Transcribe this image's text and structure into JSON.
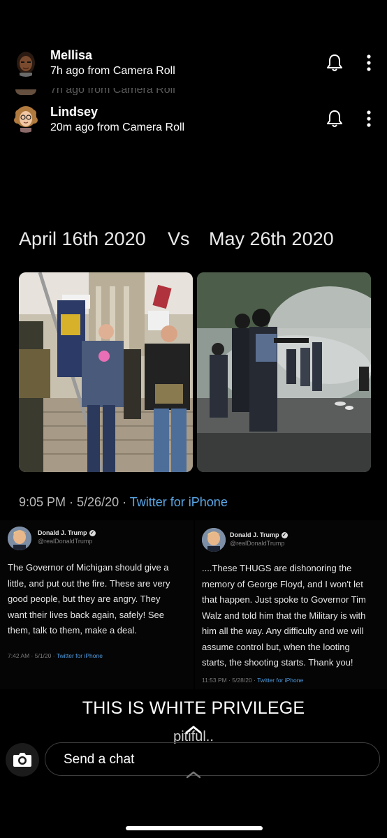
{
  "notifications": [
    {
      "name": "Mellisa",
      "subtitle": "7h ago from Camera Roll"
    },
    {
      "name": "Lindsey",
      "subtitle": "20m ago from Camera Roll"
    }
  ],
  "icons": {
    "bell": "bell-icon",
    "more": "more-vertical-icon",
    "camera": "camera-icon",
    "chevron": "chevron-up-icon"
  },
  "snap": {
    "headline_left": "April 16th 2020",
    "headline_vs": "Vs",
    "headline_right": "May 26th 2020",
    "tweet_meta_time": "9:05 PM · 5/26/20 · ",
    "tweet_meta_source": "Twitter for iPhone",
    "tweets": [
      {
        "name": "Donald J. Trump",
        "handle": "@realDonaldTrump",
        "lines": [
          "The Governor of Michigan should give a",
          "little, and put out the fire. These are very",
          "good people, but they are angry. They",
          "want their lives back again, safely! See",
          "them, talk to them, make a deal."
        ],
        "footer_time": "7:42 AM · 5/1/20 · ",
        "footer_source": "Twitter for iPhone"
      },
      {
        "name": "Donald J. Trump",
        "handle": "@realDonaldTrump",
        "lines": [
          "....These THUGS are dishonoring the",
          "memory of George Floyd, and I won't let",
          "that happen. Just spoke to Governor Tim",
          "Walz and told him that the Military is with",
          "him all the way. Any difficulty and we will",
          "assume control but, when the looting",
          "starts, the shooting starts. Thank you!"
        ],
        "footer_time": "11:53 PM · 5/28/20 · ",
        "footer_source": "Twitter for iPhone"
      }
    ],
    "caption": "THIS IS WHITE PRIVILEGE",
    "overlay_text": "pitiful.."
  },
  "chat": {
    "placeholder": "Send a chat"
  },
  "colors": {
    "background": "#000000",
    "link": "#5aa8e8",
    "chat_border": "#3e3e3e"
  }
}
